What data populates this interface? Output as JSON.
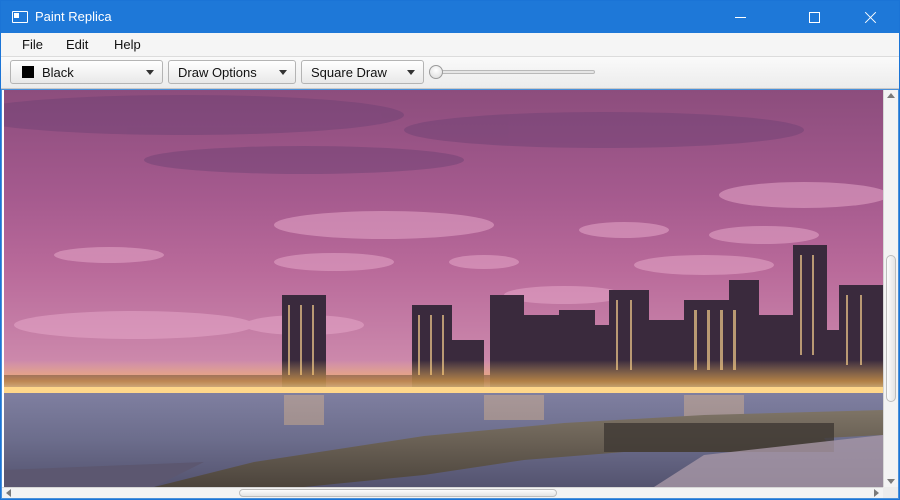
{
  "window": {
    "title": "Paint Replica",
    "accent_color": "#1e78d8"
  },
  "menubar": {
    "items": [
      {
        "label": "File"
      },
      {
        "label": "Edit"
      },
      {
        "label": "Help"
      }
    ]
  },
  "toolbar": {
    "color_select": {
      "value": "Black",
      "swatch_color": "#000000"
    },
    "draw_options_select": {
      "value": "Draw Options"
    },
    "shape_select": {
      "value": "Square Draw"
    },
    "brush_size_slider": {
      "value_fraction": 0.0
    }
  },
  "canvas": {
    "image": "city-skyline-at-dusk",
    "vertical_scroll_fraction": 0.55,
    "horizontal_scroll_fraction": 0.4
  },
  "icons": {
    "app": "app-window-icon",
    "minimize": "minimize-icon",
    "maximize": "maximize-icon",
    "close": "close-icon",
    "dropdown": "chevron-down-icon"
  }
}
